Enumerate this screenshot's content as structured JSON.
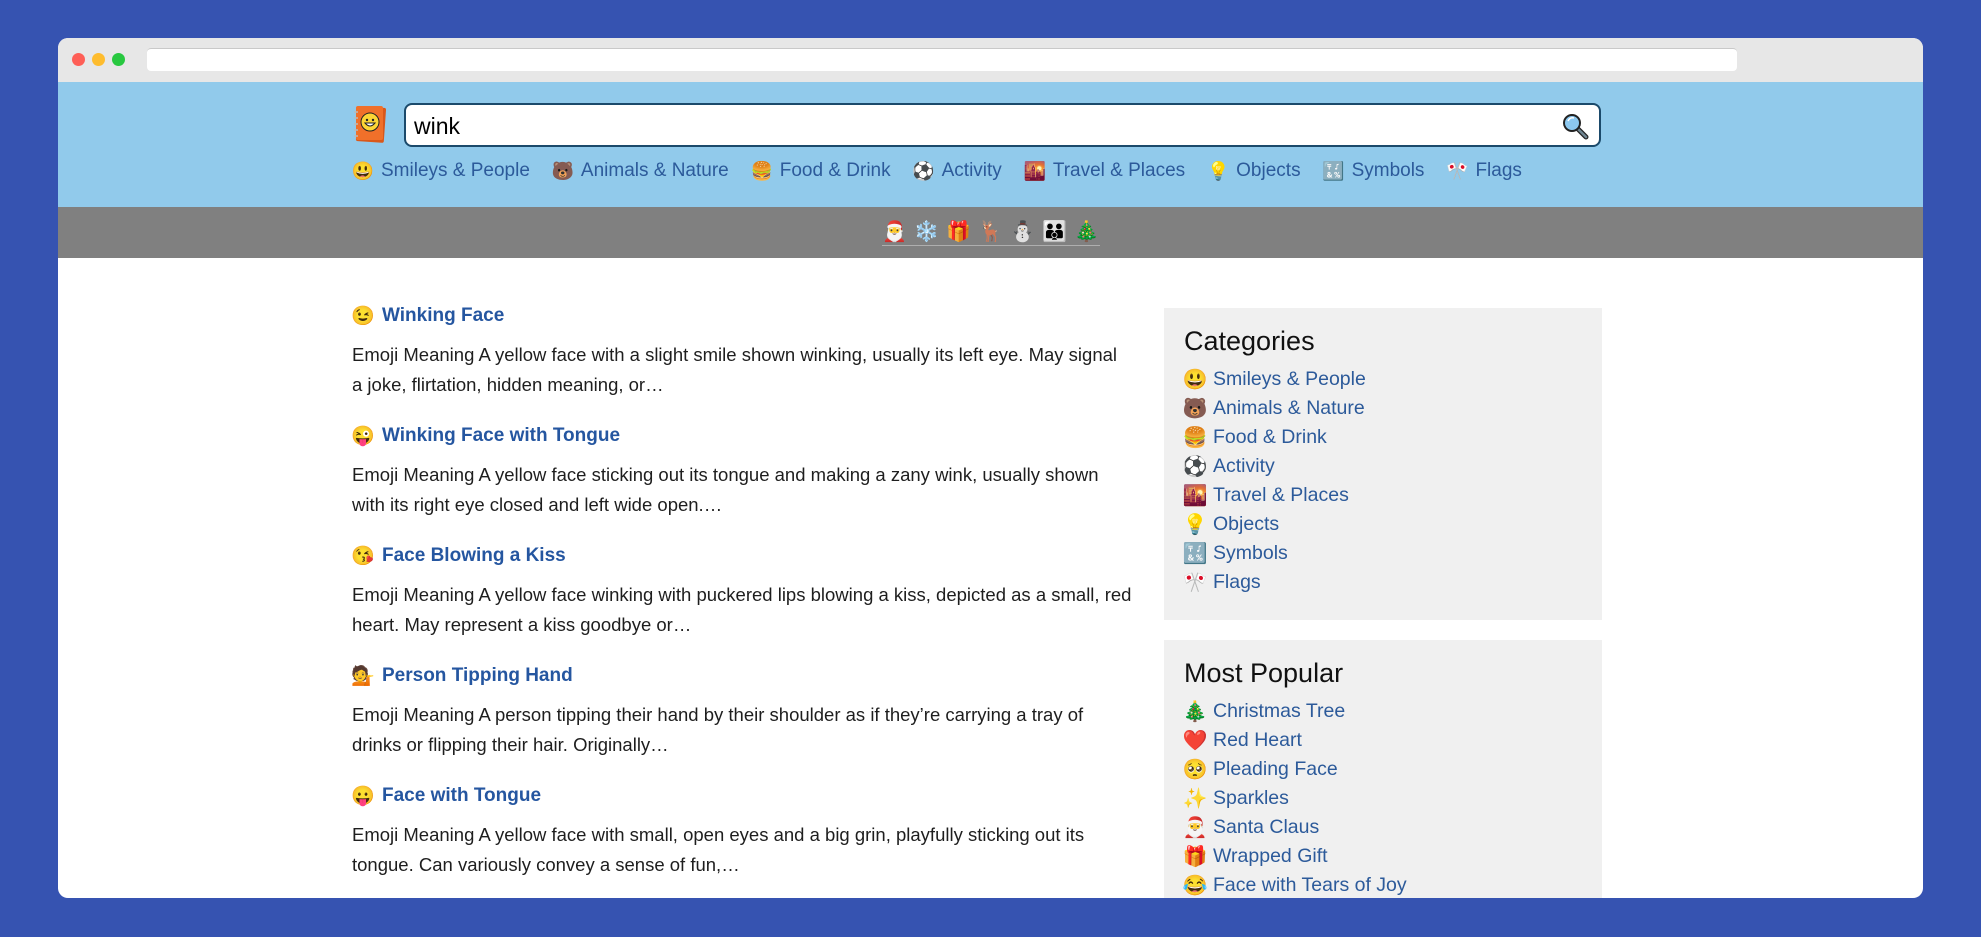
{
  "browser": {
    "address_value": ""
  },
  "header": {
    "logo_icon": "📙",
    "search": {
      "value": "wink",
      "placeholder": "",
      "button_icon": "🔍"
    },
    "categories": [
      {
        "icon": "😃",
        "label": "Smileys & People"
      },
      {
        "icon": "🐻",
        "label": "Animals & Nature"
      },
      {
        "icon": "🍔",
        "label": "Food & Drink"
      },
      {
        "icon": "⚽",
        "label": "Activity"
      },
      {
        "icon": "🌇",
        "label": "Travel & Places"
      },
      {
        "icon": "💡",
        "label": "Objects"
      },
      {
        "icon": "🔣",
        "label": "Symbols"
      },
      {
        "icon": "🎌",
        "label": "Flags"
      }
    ]
  },
  "holiday_bar": {
    "emojis": [
      "🎅",
      "❄️",
      "🎁",
      "🦌",
      "⛄",
      "👪",
      "🎄"
    ]
  },
  "results": [
    {
      "icon": "😉",
      "title": "Winking Face",
      "description": "Emoji Meaning A yellow face with a slight smile shown winking, usually its left eye. May signal a joke, flirtation, hidden meaning, or…"
    },
    {
      "icon": "😜",
      "title": "Winking Face with Tongue",
      "description": "Emoji Meaning A yellow face sticking out its tongue and making a zany wink, usually shown with its right eye closed and left wide open.…"
    },
    {
      "icon": "😘",
      "title": "Face Blowing a Kiss",
      "description": "Emoji Meaning A yellow face winking with puckered lips blowing a kiss, depicted as a small, red heart. May represent a kiss goodbye or…"
    },
    {
      "icon": "💁",
      "title": "Person Tipping Hand",
      "description": "Emoji Meaning A person tipping their hand by their shoulder as if they’re carrying a tray of drinks or flipping their hair. Originally…"
    },
    {
      "icon": "😛",
      "title": "Face with Tongue",
      "description": "Emoji Meaning A yellow face with small, open eyes and a big grin, playfully sticking out its tongue. Can variously convey a sense of fun,…"
    }
  ],
  "sidebar": {
    "categories": {
      "title": "Categories",
      "items": [
        {
          "icon": "😃",
          "label": "Smileys & People"
        },
        {
          "icon": "🐻",
          "label": "Animals & Nature"
        },
        {
          "icon": "🍔",
          "label": "Food & Drink"
        },
        {
          "icon": "⚽",
          "label": "Activity"
        },
        {
          "icon": "🌇",
          "label": "Travel & Places"
        },
        {
          "icon": "💡",
          "label": "Objects"
        },
        {
          "icon": "🔣",
          "label": "Symbols"
        },
        {
          "icon": "🎌",
          "label": "Flags"
        }
      ]
    },
    "most_popular": {
      "title": "Most Popular",
      "items": [
        {
          "icon": "🎄",
          "label": "Christmas Tree"
        },
        {
          "icon": "❤️",
          "label": "Red Heart"
        },
        {
          "icon": "🥺",
          "label": "Pleading Face"
        },
        {
          "icon": "✨",
          "label": "Sparkles"
        },
        {
          "icon": "🎅",
          "label": "Santa Claus"
        },
        {
          "icon": "🎁",
          "label": "Wrapped Gift"
        },
        {
          "icon": "😂",
          "label": "Face with Tears of Joy"
        }
      ]
    }
  },
  "colors": {
    "page_background": "#3653b1",
    "header_background": "#91caeb",
    "holiday_bar_background": "#808080",
    "link": "#2c5a9a",
    "result_title": "#2556a0",
    "sidebar_background": "#f0f0f0"
  }
}
